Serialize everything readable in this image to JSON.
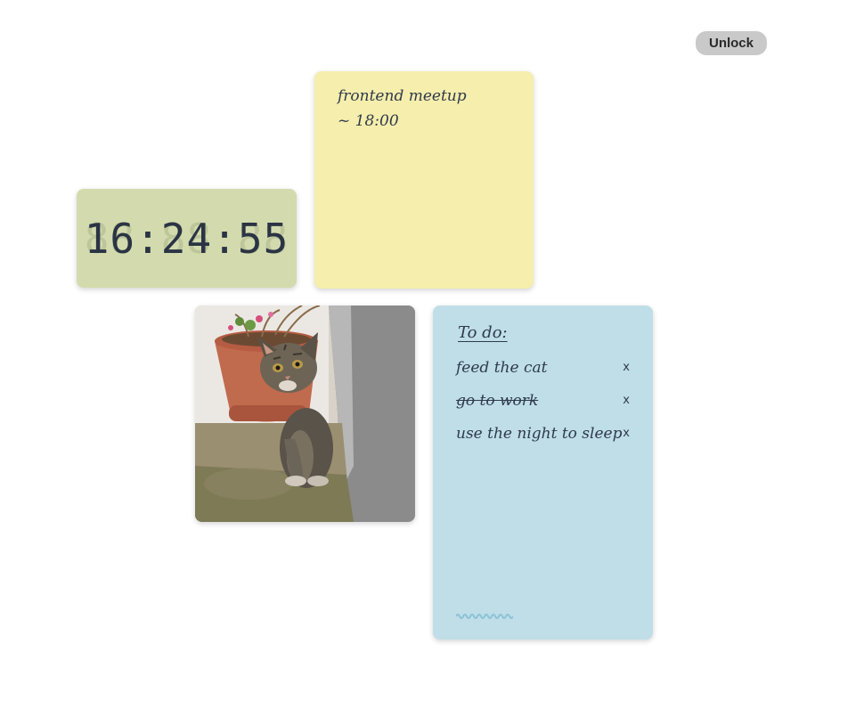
{
  "toolbar": {
    "unlock_label": "Unlock"
  },
  "clock": {
    "time": "16:24:55",
    "ghost": "88:88:88"
  },
  "note": {
    "lines": [
      "frontend meetup",
      "~ 18:00"
    ]
  },
  "photo": {
    "subject": "kitten by a flower pot"
  },
  "todo": {
    "title": "To do:",
    "items": [
      {
        "text": "feed the cat",
        "done": false,
        "remove": "x"
      },
      {
        "text": "go to work",
        "done": true,
        "remove": "x"
      },
      {
        "text": "use the night to sleep",
        "done": false,
        "remove": "x"
      }
    ]
  },
  "colors": {
    "clock_bg": "#d3dbae",
    "note_bg": "#f5eeac",
    "todo_bg": "#bfdee8",
    "ink": "#2f3a4c",
    "button_bg": "#c9c9c9"
  }
}
